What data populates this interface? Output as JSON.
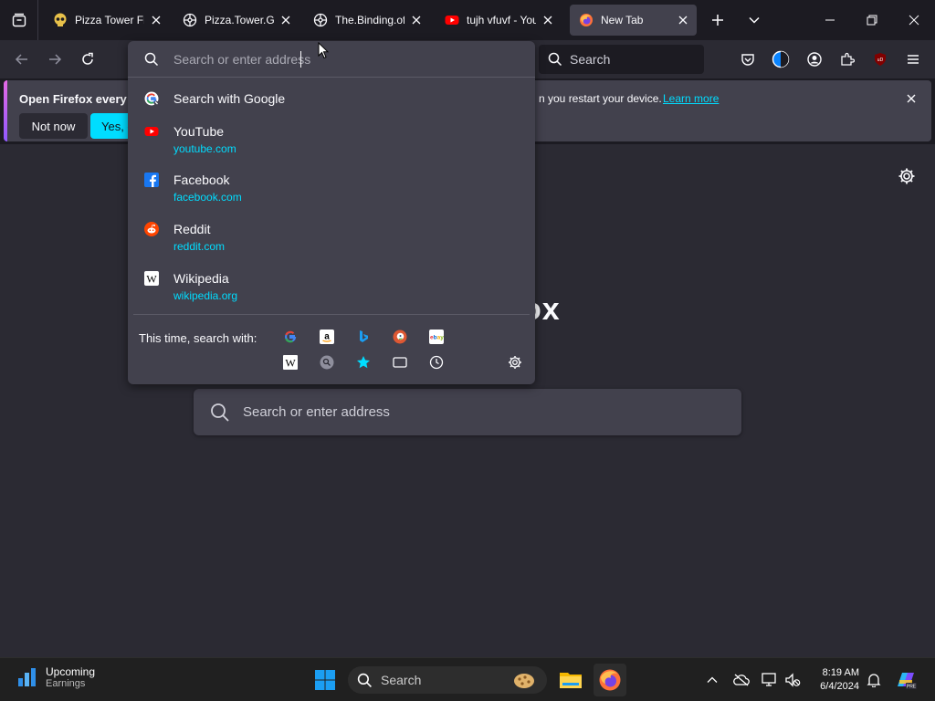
{
  "tabs": [
    {
      "title": "Pizza Tower Free",
      "icon": "skull-favicon-icon",
      "active": false
    },
    {
      "title": "Pizza.Tower.Gam",
      "icon": "globe-favicon-icon",
      "active": false
    },
    {
      "title": "The.Binding.of.I",
      "icon": "globe-favicon-icon",
      "active": false
    },
    {
      "title": "tujh vfuvf - You",
      "icon": "youtube-favicon-icon",
      "active": false
    },
    {
      "title": "New Tab",
      "icon": "firefox-favicon-icon",
      "active": true
    }
  ],
  "toolbar": {
    "search_label": "Search"
  },
  "urlbar": {
    "placeholder": "Search or enter address",
    "suggestions": [
      {
        "title": "Search with Google",
        "url": "",
        "icon": "google-icon"
      },
      {
        "title": "YouTube",
        "url": "youtube.com",
        "icon": "youtube-icon"
      },
      {
        "title": "Facebook",
        "url": "facebook.com",
        "icon": "facebook-icon"
      },
      {
        "title": "Reddit",
        "url": "reddit.com",
        "icon": "reddit-icon"
      },
      {
        "title": "Wikipedia",
        "url": "wikipedia.org",
        "icon": "wikipedia-icon"
      }
    ],
    "one_off_label": "This time, search with:",
    "engines_row1": [
      "google-icon",
      "amazon-icon",
      "bing-icon",
      "duckduckgo-icon",
      "ebay-icon"
    ],
    "engines_row2": [
      "wikipedia-icon",
      "search-engine-icon",
      "bookmarks-star-icon",
      "tabs-icon",
      "history-icon"
    ]
  },
  "notification": {
    "text_start": "Open Firefox every ti",
    "text_end": "n you restart your device.",
    "learn_more": "Learn more",
    "not_now": "Not now",
    "yes": "Yes, c"
  },
  "newtab": {
    "logo_text": "ox",
    "search_placeholder": "Search or enter address"
  },
  "taskbar": {
    "widget_title": "Upcoming",
    "widget_subtitle": "Earnings",
    "search_label": "Search",
    "time": "8:19 AM",
    "date": "6/4/2024"
  },
  "colors": {
    "accent_cyan": "#00ddff",
    "panel_bg": "#42414d",
    "toolbar_bg": "#2b2a33",
    "frame_bg": "#1c1b22"
  }
}
